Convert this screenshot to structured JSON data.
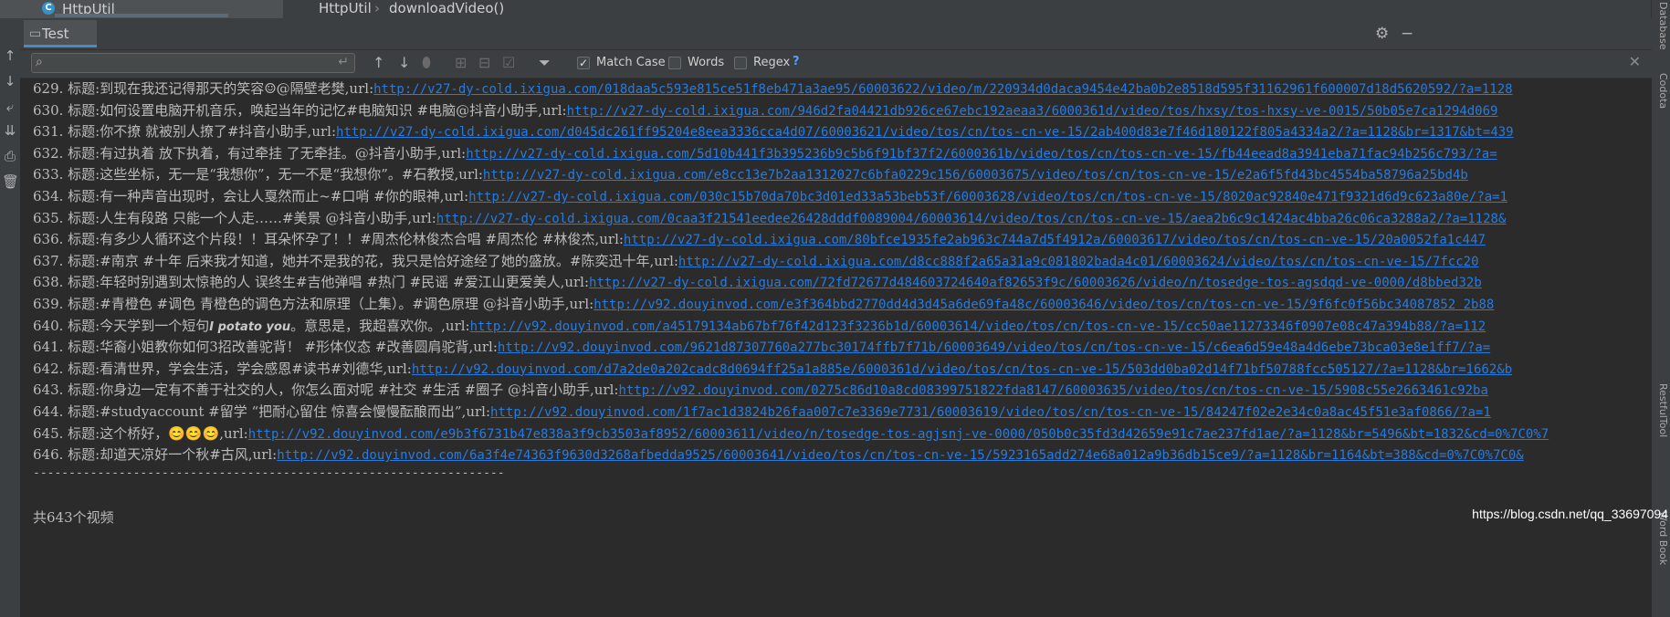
{
  "editor": {
    "file_tab": "HttpUtil",
    "breadcrumb": [
      "HttpUtil",
      "downloadVideo()"
    ],
    "file_icon": "class-icon"
  },
  "run": {
    "tab_label": "Test",
    "header_icons": [
      "gear-icon",
      "minimize-icon"
    ]
  },
  "search": {
    "value": "",
    "options": [
      {
        "label": "Match Case",
        "checked": true
      },
      {
        "label": "Words",
        "checked": false
      },
      {
        "label": "Regex",
        "checked": false
      }
    ],
    "help": "?"
  },
  "console": {
    "lines": [
      {
        "prefix": "629. 标题:到现在我还记得那天的笑容☺@隔壁老樊,url:",
        "url": "http://v27-dy-cold.ixigua.com/018daa5c593e815ce51f8eb471a3ae95/60003622/video/m/220934d0daca9454e42ba0b2e8518d595f31162961f600007d18d5620592/?a=1128"
      },
      {
        "prefix": "630. 标题:如何设置电脑开机音乐，唤起当年的记忆#电脑知识 #电脑@抖音小助手,url:",
        "url": "http://v27-dy-cold.ixigua.com/946d2fa04421db926ce67ebc192aeaa3/6000361d/video/tos/hxsy/tos-hxsy-ve-0015/50b05e7ca1294d069"
      },
      {
        "prefix": "631. 标题:你不撩 就被别人撩了#抖音小助手,url:",
        "url": "http://v27-dy-cold.ixigua.com/d045dc261ff95204e8eea3336cca4d07/60003621/video/tos/cn/tos-cn-ve-15/2ab400d83e7f46d180122f805a4334a2/?a=1128&br=1317&bt=439"
      },
      {
        "prefix": "632. 标题:有过执着 放下执着，有过牵挂 了无牵挂。@抖音小助手,url:",
        "url": "http://v27-dy-cold.ixigua.com/5d10b441f3b395236b9c5b6f91bf37f2/6000361b/video/tos/cn/tos-cn-ve-15/fb44eead8a3941eba71fac94b256c793/?a="
      },
      {
        "prefix": "633. 标题:这些坐标，无一是“我想你”，无一不是“我想你”。#石教授,url:",
        "url": "http://v27-dy-cold.ixigua.com/e8cc13e7b2aa1312027c6bfa0229c156/60003675/video/tos/cn/tos-cn-ve-15/e2a6f5fd43bc4554ba58796a25bd4b"
      },
      {
        "prefix": "634. 标题:有一种声音出现时，会让人戛然而止~#口哨 #你的眼神,url:",
        "url": "http://v27-dy-cold.ixigua.com/030c15b70da70bc3d01ed33a53beb53f/60003628/video/tos/cn/tos-cn-ve-15/8020ac92840e471f9321d6d9c623a80e/?a=1"
      },
      {
        "prefix": "635. 标题:人生有段路 只能一个人走……#美景 @抖音小助手,url:",
        "url": "http://v27-dy-cold.ixigua.com/0caa3f21541eedee26428dddf0089004/60003614/video/tos/cn/tos-cn-ve-15/aea2b6c9c1424ac4bba26c06ca3288a2/?a=1128&"
      },
      {
        "prefix": "636. 标题:有多少人循环这个片段！！耳朵怀孕了！！#周杰伦林俊杰合唱 #周杰伦 #林俊杰,url:",
        "url": "http://v27-dy-cold.ixigua.com/80bfce1935fe2ab963c744a7d5f4912a/60003617/video/tos/cn/tos-cn-ve-15/20a0052fa1c447"
      },
      {
        "prefix": "637. 标题:#南京 #十年 后来我才知道，她并不是我的花，我只是恰好途经了她的盛放。#陈奕迅十年,url:",
        "url": "http://v27-dy-cold.ixigua.com/d8cc888f2a65a31a9c081802bada4c01/60003624/video/tos/cn/tos-cn-ve-15/7fcc20"
      },
      {
        "prefix": "638. 标题:年轻时别遇到太惊艳的人  误终生#吉他弹唱 #热门 #民谣 #爱江山更爱美人,url:",
        "url": "http://v27-dy-cold.ixigua.com/72fd72677d484603724640af82653f9c/60003626/video/n/tosedge-tos-agsdqd-ve-0000/d8bbed32b"
      },
      {
        "prefix": "639. 标题:#青橙色 #调色 青橙色的调色方法和原理（上集）。#调色原理 @抖音小助手,url:",
        "url": "http://v92.douyinvod.com/e3f364bbd2770dd4d3d45a6de69fa48c/60003646/video/tos/cn/tos-cn-ve-15/9f6fc0f56bc34087852 2b88"
      },
      {
        "prefix": "640. 标题:今天学到一个短句",
        "em": "I potato you",
        "mid": "。意思是，我超喜欢你。,url:",
        "url": "http://v92.douyinvod.com/a45179134ab67bf76f42d123f3236b1d/60003614/video/tos/cn/tos-cn-ve-15/cc50ae11273346f0907e08c47a394b88/?a=112"
      },
      {
        "prefix": "641. 标题:华裔小姐教你如何3招改善驼背！ #形体仪态  #改善圆肩驼背,url:",
        "url": "http://v92.douyinvod.com/9621d87307760a277bc30174ffb7f71b/60003649/video/tos/cn/tos-cn-ve-15/c6ea6d59e48a4d6ebe73bca03e8e1ff7/?a="
      },
      {
        "prefix": "642. 标题:看清世界，学会生活，学会感恩#读书#刘德华,url:",
        "url": "http://v92.douyinvod.com/d7a2de0a202cadc8d0694ff25a1a885e/6000361d/video/tos/cn/tos-cn-ve-15/503dd0ba02d14f71bf50788fcc505127/?a=1128&br=1662&b"
      },
      {
        "prefix": "643. 标题:你身边一定有不善于社交的人，你怎么面对呢 #社交 #生活 #圈子 @抖音小助手,url:",
        "url": "http://v92.douyinvod.com/0275c86d10a8cd08399751822fda8147/60003635/video/tos/cn/tos-cn-ve-15/5908c55e2663461c92ba"
      },
      {
        "prefix": "644. 标题:#studyaccount #留学 “把耐心留住 惊喜会慢慢酝酿而出”,url:",
        "url": "http://v92.douyinvod.com/1f7ac1d3824b26faa007c7e3369e7731/60003619/video/tos/cn/tos-cn-ve-15/84247f02e2e34c0a8ac45f51e3af0866/?a=1"
      },
      {
        "prefix": "645. 标题:这个桥好，😊😊😊,url:",
        "url": "http://v92.douyinvod.com/e9b3f6731b47e838a3f9cb3503af8952/60003611/video/n/tosedge-tos-agjsnj-ve-0000/050b0c35fd3d42659e91c7ae237fd1ae/?a=1128&br=5496&bt=1832&cd=0%7C0%7"
      },
      {
        "prefix": "646. 标题:却道天凉好一个秋#古风,url:",
        "url": "http://v92.douyinvod.com/6a3f4e74363f9630d3268afbedda9525/60003641/video/tos/cn/tos-cn-ve-15/5923165add274e68a012a9b36db15ce9/?a=1128&br=1164&bt=388&cd=0%7C0%7C0&"
      }
    ],
    "separator": "------------------------------------------------------------------",
    "summary": "共643个视频"
  },
  "watermark": "https://blog.csdn.net/qq_33697094",
  "right_strip": [
    "Database",
    "Codota",
    "RestfulTool",
    "Word Book"
  ],
  "colors": {
    "background": "#2b2b2b",
    "link": "#287bde",
    "text": "#bbbbbb",
    "accent": "#4a88c7"
  }
}
